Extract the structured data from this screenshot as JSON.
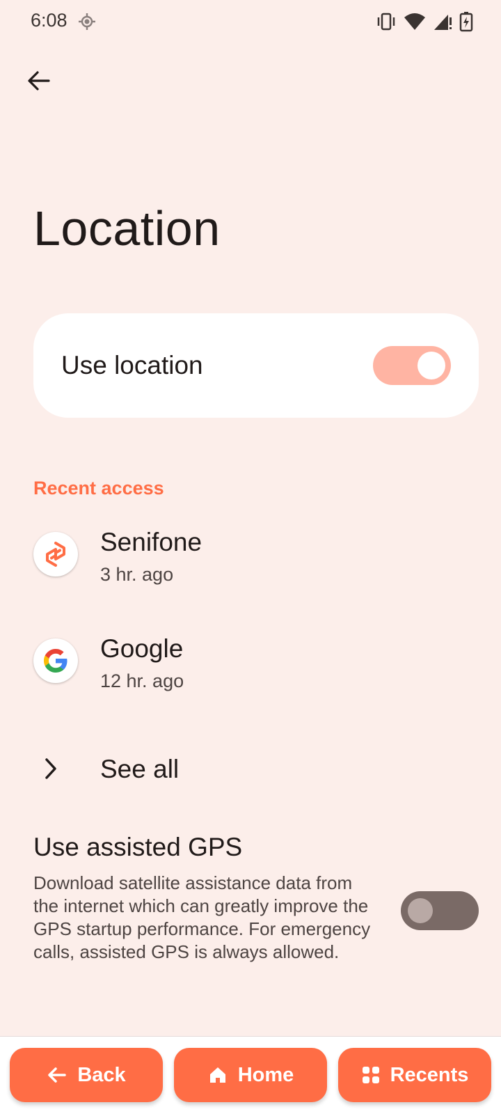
{
  "status_bar": {
    "time": "6:08"
  },
  "page": {
    "title": "Location"
  },
  "use_location": {
    "label": "Use location",
    "enabled": true
  },
  "recent_access": {
    "header": "Recent access",
    "items": [
      {
        "name": "Senifone",
        "time": "3 hr. ago",
        "icon": "senifone-icon"
      },
      {
        "name": "Google",
        "time": "12 hr. ago",
        "icon": "google-icon"
      }
    ],
    "see_all": "See all"
  },
  "assisted_gps": {
    "title": "Use assisted GPS",
    "description": "Download satellite assistance data from the internet which can greatly improve the GPS startup performance. For emergency calls, assisted GPS is always allowed.",
    "enabled": false
  },
  "bottom_nav": {
    "back": "Back",
    "home": "Home",
    "recents": "Recents"
  },
  "colors": {
    "accent": "#FF6D45",
    "background": "#FCEEEA",
    "switch_on": "#FFB4A3",
    "switch_off": "#7A6A66"
  }
}
